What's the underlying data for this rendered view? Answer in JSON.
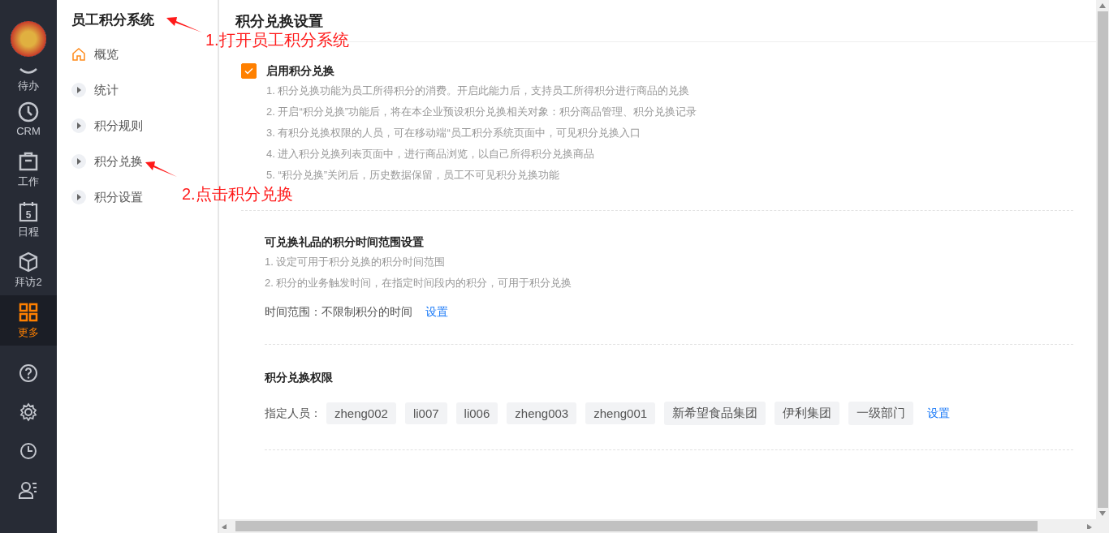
{
  "rail": {
    "items": [
      {
        "label": "待办",
        "selected": false
      },
      {
        "label": "CRM",
        "selected": false
      },
      {
        "label": "工作",
        "selected": false
      },
      {
        "label": "日程",
        "selected": false,
        "badge": "5"
      },
      {
        "label": "拜访2",
        "selected": false
      },
      {
        "label": "更多",
        "selected": true
      }
    ]
  },
  "menu": {
    "title": "员工积分系统",
    "items": [
      {
        "label": "概览",
        "kind": "home",
        "selected": false
      },
      {
        "label": "统计",
        "kind": "arrow",
        "selected": false
      },
      {
        "label": "积分规则",
        "kind": "arrow",
        "selected": false
      },
      {
        "label": "积分兑换",
        "kind": "arrow",
        "selected": false
      },
      {
        "label": "积分设置",
        "kind": "arrow",
        "selected": false
      }
    ]
  },
  "page": {
    "title": "积分兑换设置",
    "enable": {
      "label": "启用积分兑换",
      "checked": true,
      "notes": [
        "1. 积分兑换功能为员工所得积分的消费。开启此能力后，支持员工所得积分进行商品的兑换",
        "2. 开启“积分兑换”功能后，将在本企业预设积分兑换相关对象：积分商品管理、积分兑换记录",
        "3. 有积分兑换权限的人员，可在移动端“员工积分系统页面中，可见积分兑换入口",
        "4. 进入积分兑换列表页面中，进行商品浏览，以自己所得积分兑换商品",
        "5. “积分兑换”关闭后，历史数据保留，员工不可见积分兑换功能"
      ]
    },
    "time_range": {
      "title": "可兑换礼品的积分时间范围设置",
      "notes": [
        "1. 设定可用于积分兑换的积分时间范围",
        "2. 积分的业务触发时间，在指定时间段内的积分，可用于积分兑换"
      ],
      "label": "时间范围：",
      "value": "不限制积分的时间",
      "link": "设置"
    },
    "permission": {
      "title": "积分兑换权限",
      "label": "指定人员：",
      "tags": [
        "zheng002",
        "li007",
        "li006",
        "zheng003",
        "zheng001",
        "新希望食品集团",
        "伊利集团",
        "一级部门"
      ],
      "link": "设置"
    }
  },
  "annotations": [
    {
      "text": "1.打开员工积分系统"
    },
    {
      "text": "2.点击积分兑换"
    }
  ]
}
